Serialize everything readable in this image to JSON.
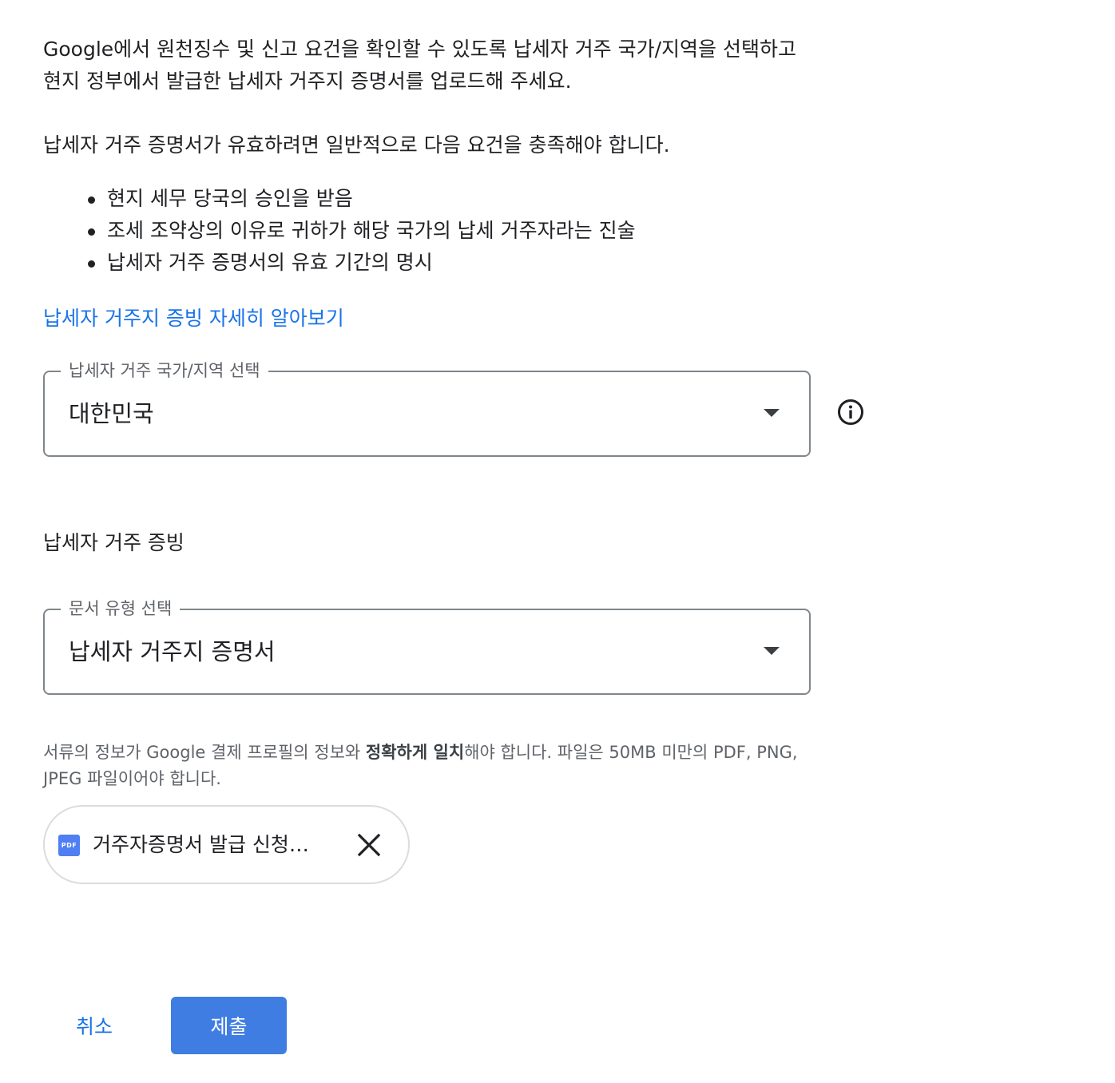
{
  "intro": {
    "text": "Google에서 원천징수 및 신고 요건을 확인할 수 있도록 납세자 거주 국가/지역을 선택하고 현지 정부에서 발급한 납세자 거주지 증명서를 업로드해 주세요.",
    "requirements_intro": "납세자 거주 증명서가 유효하려면 일반적으로 다음 요건을 충족해야 합니다.",
    "requirements": [
      "현지 세무 당국의 승인을 받음",
      "조세 조약상의 이유로 귀하가 해당 국가의 납세 거주자라는 진술",
      "납세자 거주 증명서의 유효 기간의 명시"
    ],
    "learn_more_link": "납세자 거주지 증빙 자세히 알아보기"
  },
  "country_select": {
    "label": "납세자 거주 국가/지역 선택",
    "value": "대한민국"
  },
  "proof_section": {
    "heading": "납세자 거주 증빙",
    "document_type_select": {
      "label": "문서 유형 선택",
      "value": "납세자 거주지 증명서"
    },
    "hint": {
      "before": "서류의 정보가 Google 결제 프로필의 정보와 ",
      "emphasis": "정확하게 일치",
      "after": "해야 합니다. 파일은 50MB 미만의 PDF, PNG, JPEG 파일이어야 합니다."
    },
    "uploaded_file": {
      "icon_label": "PDF",
      "name": "거주자증명서 발급 신청…"
    }
  },
  "actions": {
    "cancel_label": "취소",
    "submit_label": "제출"
  },
  "colors": {
    "accent": "#1a73e8",
    "primary_button": "#3f7de3",
    "pdf_icon": "#4f7ff3",
    "outline": "#80868b",
    "text": "#202124"
  },
  "icons": {
    "country_info": "info-icon",
    "dropdown": "dropdown-arrow-icon",
    "file": "pdf-file-icon",
    "remove": "close-icon"
  }
}
